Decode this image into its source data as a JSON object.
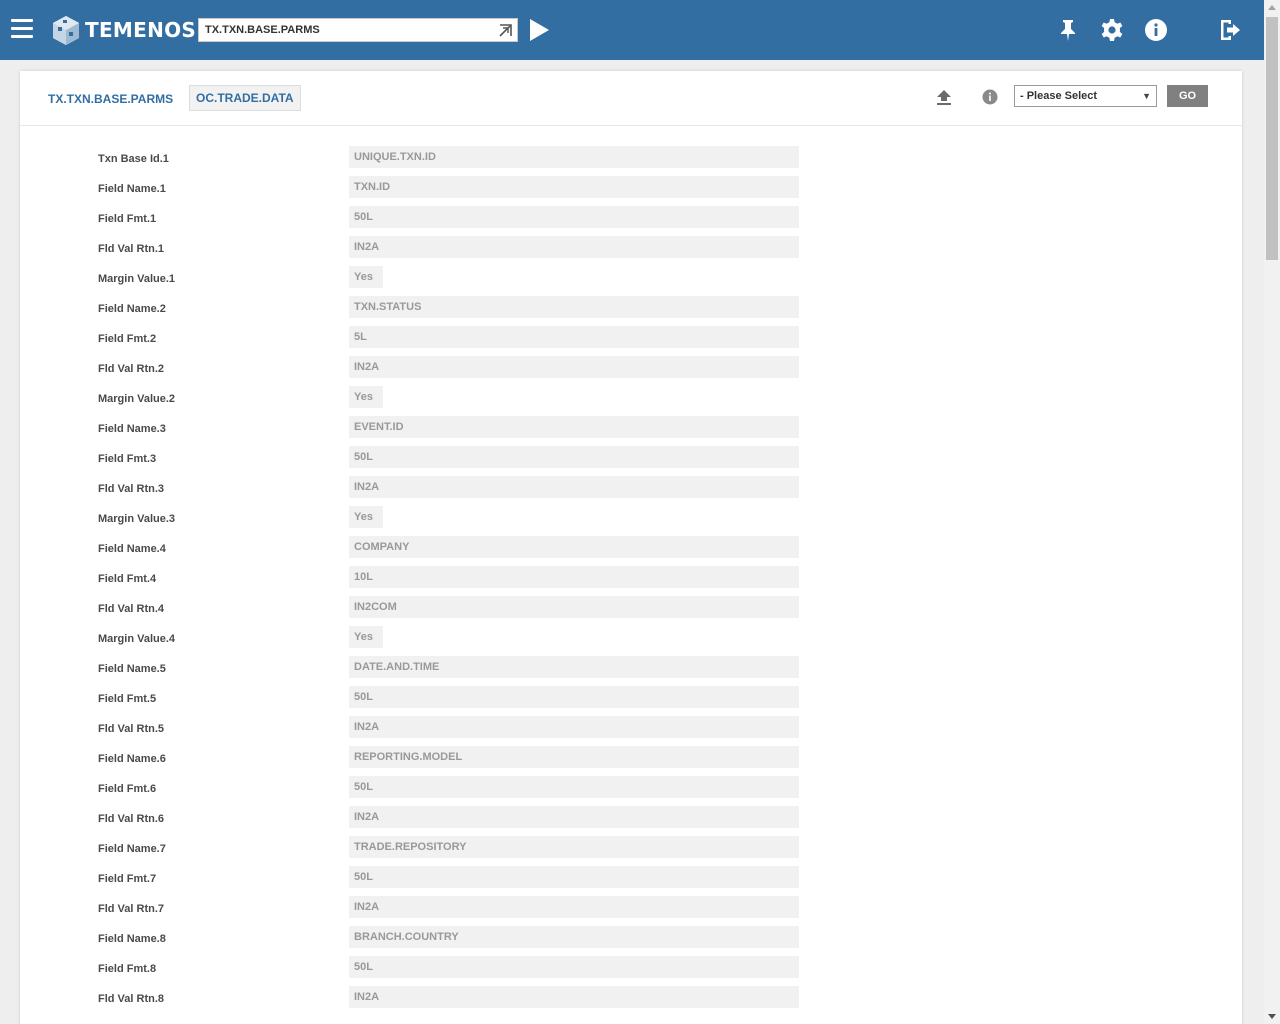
{
  "header": {
    "brand": "TEMENOS",
    "command_value": "TX.TXN.BASE.PARMS",
    "icons": [
      "menu-icon",
      "pin-icon",
      "gear-icon",
      "info-icon",
      "logout-icon"
    ],
    "color": "#336ea3"
  },
  "panel": {
    "app_name": "TX.TXN.BASE.PARMS",
    "record_id": "OC.TRADE.DATA",
    "select_value": "- Please Select",
    "go_label": "GO"
  },
  "rows": [
    {
      "label": "Txn Base Id.1",
      "value": "UNIQUE.TXN.ID"
    },
    {
      "label": "Field Name.1",
      "value": "TXN.ID"
    },
    {
      "label": "Field Fmt.1",
      "value": "50L"
    },
    {
      "label": "Fld Val Rtn.1",
      "value": "IN2A"
    },
    {
      "label": "Margin Value.1",
      "value": "Yes"
    },
    {
      "label": "Field Name.2",
      "value": "TXN.STATUS"
    },
    {
      "label": "Field Fmt.2",
      "value": "5L"
    },
    {
      "label": "Fld Val Rtn.2",
      "value": "IN2A"
    },
    {
      "label": "Margin Value.2",
      "value": "Yes"
    },
    {
      "label": "Field Name.3",
      "value": "EVENT.ID"
    },
    {
      "label": "Field Fmt.3",
      "value": "50L"
    },
    {
      "label": "Fld Val Rtn.3",
      "value": "IN2A"
    },
    {
      "label": "Margin Value.3",
      "value": "Yes"
    },
    {
      "label": "Field Name.4",
      "value": "COMPANY"
    },
    {
      "label": "Field Fmt.4",
      "value": "10L"
    },
    {
      "label": "Fld Val Rtn.4",
      "value": "IN2COM"
    },
    {
      "label": "Margin Value.4",
      "value": "Yes"
    },
    {
      "label": "Field Name.5",
      "value": "DATE.AND.TIME"
    },
    {
      "label": "Field Fmt.5",
      "value": "50L"
    },
    {
      "label": "Fld Val Rtn.5",
      "value": "IN2A"
    },
    {
      "label": "Field Name.6",
      "value": "REPORTING.MODEL"
    },
    {
      "label": "Field Fmt.6",
      "value": "50L"
    },
    {
      "label": "Fld Val Rtn.6",
      "value": "IN2A"
    },
    {
      "label": "Field Name.7",
      "value": "TRADE.REPOSITORY"
    },
    {
      "label": "Field Fmt.7",
      "value": "50L"
    },
    {
      "label": "Fld Val Rtn.7",
      "value": "IN2A"
    },
    {
      "label": "Field Name.8",
      "value": "BRANCH.COUNTRY"
    },
    {
      "label": "Field Fmt.8",
      "value": "50L"
    },
    {
      "label": "Fld Val Rtn.8",
      "value": "IN2A"
    }
  ]
}
